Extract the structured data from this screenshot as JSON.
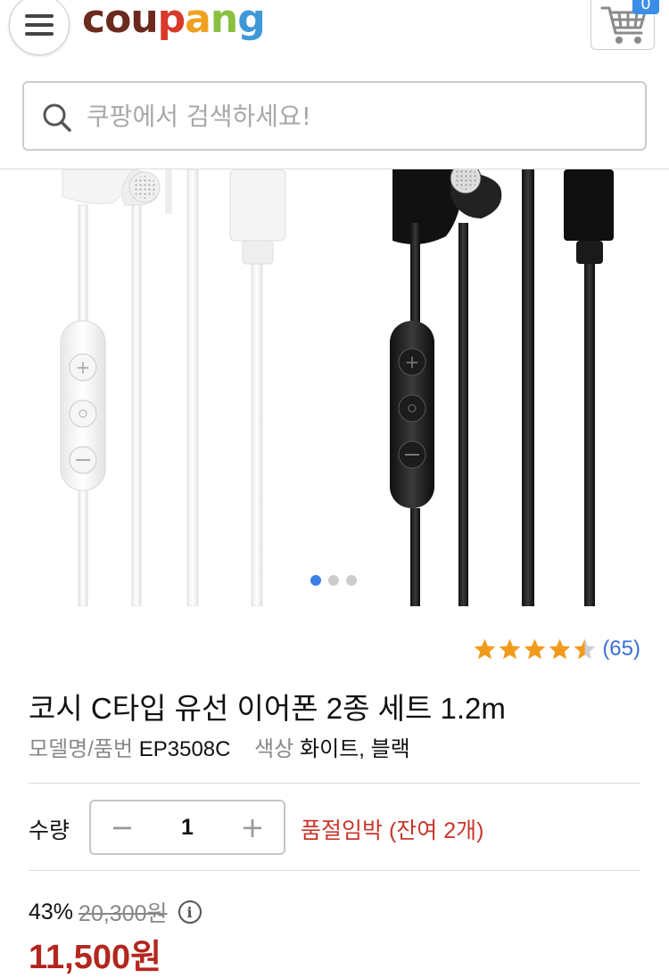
{
  "header": {
    "logo": [
      {
        "ch": "c",
        "color": "#6b2a1d"
      },
      {
        "ch": "o",
        "color": "#6b2a1d"
      },
      {
        "ch": "u",
        "color": "#6b2a1d"
      },
      {
        "ch": "p",
        "color": "#d8392b"
      },
      {
        "ch": "a",
        "color": "#f0a020"
      },
      {
        "ch": "n",
        "color": "#8bbf3f"
      },
      {
        "ch": "g",
        "color": "#3e98d8"
      }
    ],
    "cart_count": "0"
  },
  "search": {
    "placeholder": "쿠팡에서 검색하세요!"
  },
  "gallery": {
    "slide_count": 3,
    "active_index": 0
  },
  "product": {
    "rating": 4.5,
    "rating_max": 5,
    "review_count": "(65)",
    "title": "코시 C타입 유선 이어폰 2종 세트 1.2m",
    "model_label": "모델명/품번",
    "model_value": "EP3508C",
    "color_label": "색상",
    "color_value": "화이트, 블랙"
  },
  "quantity": {
    "label": "수량",
    "value": "1",
    "minus": "−",
    "plus": "+",
    "stock_notice": "품절임박 (잔여 2개)"
  },
  "price": {
    "discount_rate": "43%",
    "original": "20,300원",
    "sale": "11,500원",
    "info": "i"
  },
  "colors": {
    "star_filled": "#f29a1e",
    "star_empty": "#cfcfcf",
    "price_red": "#b3261e",
    "accent_blue": "#3a6fd8"
  }
}
